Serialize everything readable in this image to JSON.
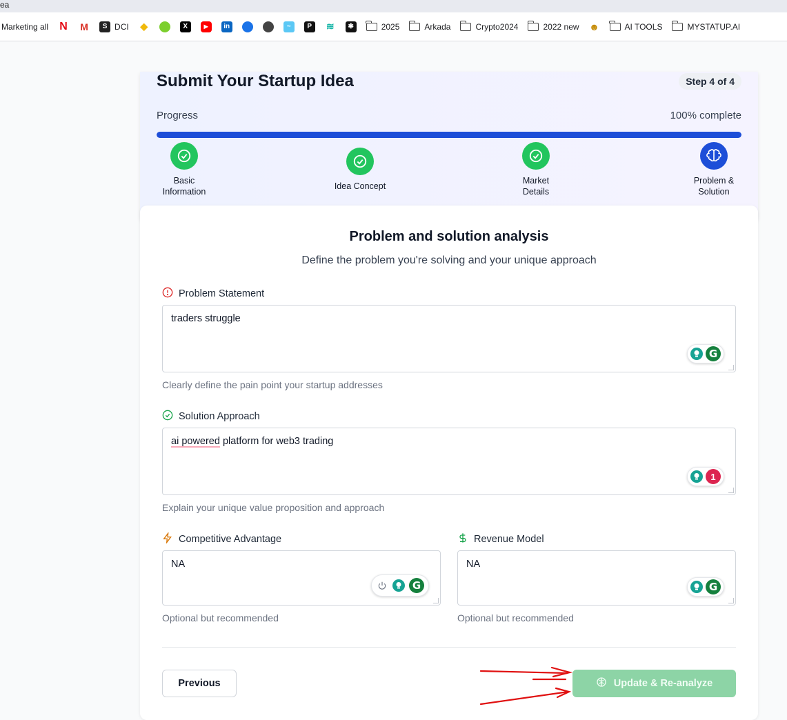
{
  "browser": {
    "tab_title_fragment": "ea",
    "bookmarks": [
      {
        "label": "Marketing all",
        "icon": "none"
      },
      {
        "label": "",
        "icon": "netflix-icon"
      },
      {
        "label": "",
        "icon": "gmail-icon"
      },
      {
        "label": "DCI",
        "icon": "dci-icon"
      },
      {
        "label": "",
        "icon": "binance-icon"
      },
      {
        "label": "",
        "icon": "green-bird-icon"
      },
      {
        "label": "",
        "icon": "x-icon"
      },
      {
        "label": "",
        "icon": "youtube-icon"
      },
      {
        "label": "",
        "icon": "linkedin-icon"
      },
      {
        "label": "",
        "icon": "blue-ship-icon"
      },
      {
        "label": "",
        "icon": "globe-icon"
      },
      {
        "label": "",
        "icon": "chart-app-icon"
      },
      {
        "label": "",
        "icon": "black-p-icon"
      },
      {
        "label": "",
        "icon": "teal-stripe-icon"
      },
      {
        "label": "",
        "icon": "puzzle-icon"
      },
      {
        "label": "2025",
        "icon": "folder-icon"
      },
      {
        "label": "Arkada",
        "icon": "folder-icon"
      },
      {
        "label": "Crypto2024",
        "icon": "folder-icon"
      },
      {
        "label": "2022 new",
        "icon": "folder-icon"
      },
      {
        "label": "",
        "icon": "robot-icon"
      },
      {
        "label": "AI TOOLS",
        "icon": "folder-icon"
      },
      {
        "label": "MYSTATUP.AI",
        "icon": "folder-icon"
      }
    ]
  },
  "progress_card": {
    "title": "Submit Your Startup Idea",
    "step_badge": "Step 4 of 4",
    "progress_label": "Progress",
    "progress_text": "100% complete",
    "progress_value": 1.0,
    "colors": {
      "done": "#22c55e",
      "current": "#1d4ed8",
      "bar": "#1d4ed8"
    },
    "steps": [
      {
        "label": "Basic Information",
        "state": "done",
        "icon": "check-circle-icon"
      },
      {
        "label": "Idea Concept",
        "state": "done",
        "icon": "check-circle-icon"
      },
      {
        "label": "Market Details",
        "state": "done",
        "icon": "check-circle-icon"
      },
      {
        "label": "Problem & Solution",
        "state": "current",
        "icon": "brain-icon"
      }
    ]
  },
  "form": {
    "title": "Problem and solution analysis",
    "subtitle": "Define the problem you're solving and your unique approach",
    "problem": {
      "label": "Problem Statement",
      "icon": "alert-circle-icon",
      "value": "traders struggle",
      "hint": "Clearly define the pain point your startup addresses"
    },
    "solution": {
      "label": "Solution Approach",
      "icon": "check-circle-icon",
      "value_underlined": "ai powered",
      "value_rest": " platform for web3 trading",
      "hint": "Explain your unique value proposition and approach",
      "grammarly_count": "1"
    },
    "advantage": {
      "label": "Competitive Advantage",
      "icon": "zap-icon",
      "value": "NA",
      "hint": "Optional but recommended"
    },
    "revenue": {
      "label": "Revenue Model",
      "icon": "dollar-icon",
      "value": "NA",
      "hint": "Optional but recommended"
    },
    "previous_label": "Previous",
    "update_label": "Update & Re-analyze"
  }
}
